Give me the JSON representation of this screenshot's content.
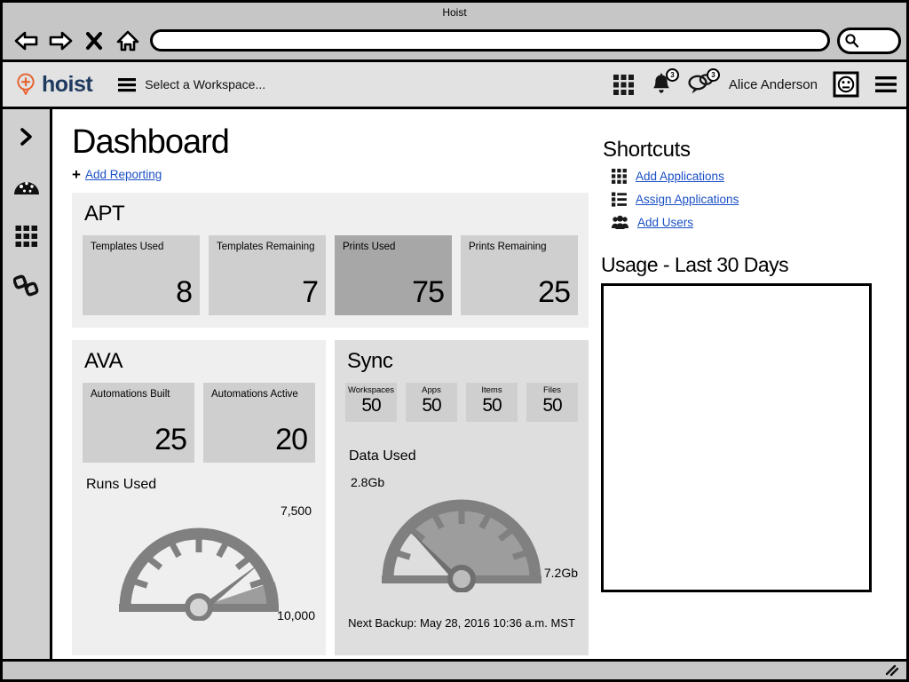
{
  "window": {
    "title": "Hoist"
  },
  "browser": {
    "back_icon": "back-arrow-icon",
    "forward_icon": "forward-arrow-icon",
    "stop_icon": "stop-x-icon",
    "home_icon": "home-icon",
    "url_value": "",
    "url_placeholder": "",
    "search_value": "",
    "search_placeholder": "",
    "search_icon": "search-icon"
  },
  "app_header": {
    "brand_text": "hoist",
    "brand_icon": "hoist-pin-plus-icon",
    "brand_color": "#1f3a5f",
    "accent_color": "#e8602c",
    "workspace_menu_icon": "hamburger-icon",
    "workspace_label": "Select a Workspace...",
    "apps_grid_icon": "apps-grid-icon",
    "notifications_icon": "bell-icon",
    "notifications_badge": "3",
    "messages_icon": "chat-bubbles-icon",
    "messages_badge": "3",
    "user_name": "Alice Anderson",
    "avatar_icon": "avatar-face-icon",
    "menu_icon": "hamburger-icon"
  },
  "left_rail": {
    "items": [
      {
        "name": "expand-rail",
        "icon": "chevron-right-icon"
      },
      {
        "name": "dashboard",
        "icon": "gauge-icon"
      },
      {
        "name": "applications",
        "icon": "grid-icon"
      },
      {
        "name": "integrations",
        "icon": "link-chain-icon"
      }
    ]
  },
  "page": {
    "title": "Dashboard",
    "add_reporting_label": "Add Reporting",
    "add_reporting_plus": "+"
  },
  "panels": {
    "apt": {
      "title": "APT",
      "tiles": [
        {
          "label": "Templates Used",
          "value": "8",
          "highlighted": false
        },
        {
          "label": "Templates Remaining",
          "value": "7",
          "highlighted": false
        },
        {
          "label": "Prints Used",
          "value": "75",
          "highlighted": true
        },
        {
          "label": "Prints Remaining",
          "value": "25",
          "highlighted": false
        }
      ]
    },
    "ava": {
      "title": "AVA",
      "tiles": [
        {
          "label": "Automations Built",
          "value": "25"
        },
        {
          "label": "Automations Active",
          "value": "20"
        }
      ],
      "gauge_heading": "Runs Used",
      "gauge_max_label": "7,500",
      "gauge_min_label": "10,000"
    },
    "sync": {
      "title": "Sync",
      "tiles": [
        {
          "label": "Workspaces",
          "value": "50"
        },
        {
          "label": "Apps",
          "value": "50"
        },
        {
          "label": "Items",
          "value": "50"
        },
        {
          "label": "Files",
          "value": "50"
        }
      ],
      "gauge_heading": "Data Used",
      "gauge_left_label": "2.8Gb",
      "gauge_right_label": "7.2Gb",
      "backup_note": "Next Backup: May 28, 2016 10:36 a.m. MST"
    }
  },
  "shortcuts": {
    "title": "Shortcuts",
    "items": [
      {
        "label": "Add Applications",
        "icon": "grid-icon"
      },
      {
        "label": "Assign Applications",
        "icon": "list-icon"
      },
      {
        "label": "Add Users",
        "icon": "users-icon"
      }
    ]
  },
  "usage": {
    "title": "Usage - Last 30 Days",
    "chart_placeholder": ""
  },
  "statusbar": {
    "resize_icon": "resize-grip-icon"
  },
  "chart_data": [
    {
      "type": "gauge",
      "title": "Runs Used",
      "value": 7500,
      "min": 0,
      "max": 10000,
      "min_label": "7,500",
      "max_label": "10,000",
      "needle_angle_deg": 35,
      "xlabel": "",
      "ylabel": ""
    },
    {
      "type": "gauge",
      "title": "Data Used",
      "value": 2.8,
      "min": 0,
      "max": 7.2,
      "min_label": "2.8Gb",
      "max_label": "7.2Gb",
      "needle_angle_deg": 145,
      "xlabel": "",
      "ylabel": ""
    },
    {
      "type": "line",
      "title": "Usage - Last 30 Days",
      "categories": [],
      "values": [],
      "xlabel": "",
      "ylabel": "",
      "note": "empty chart placeholder"
    }
  ]
}
